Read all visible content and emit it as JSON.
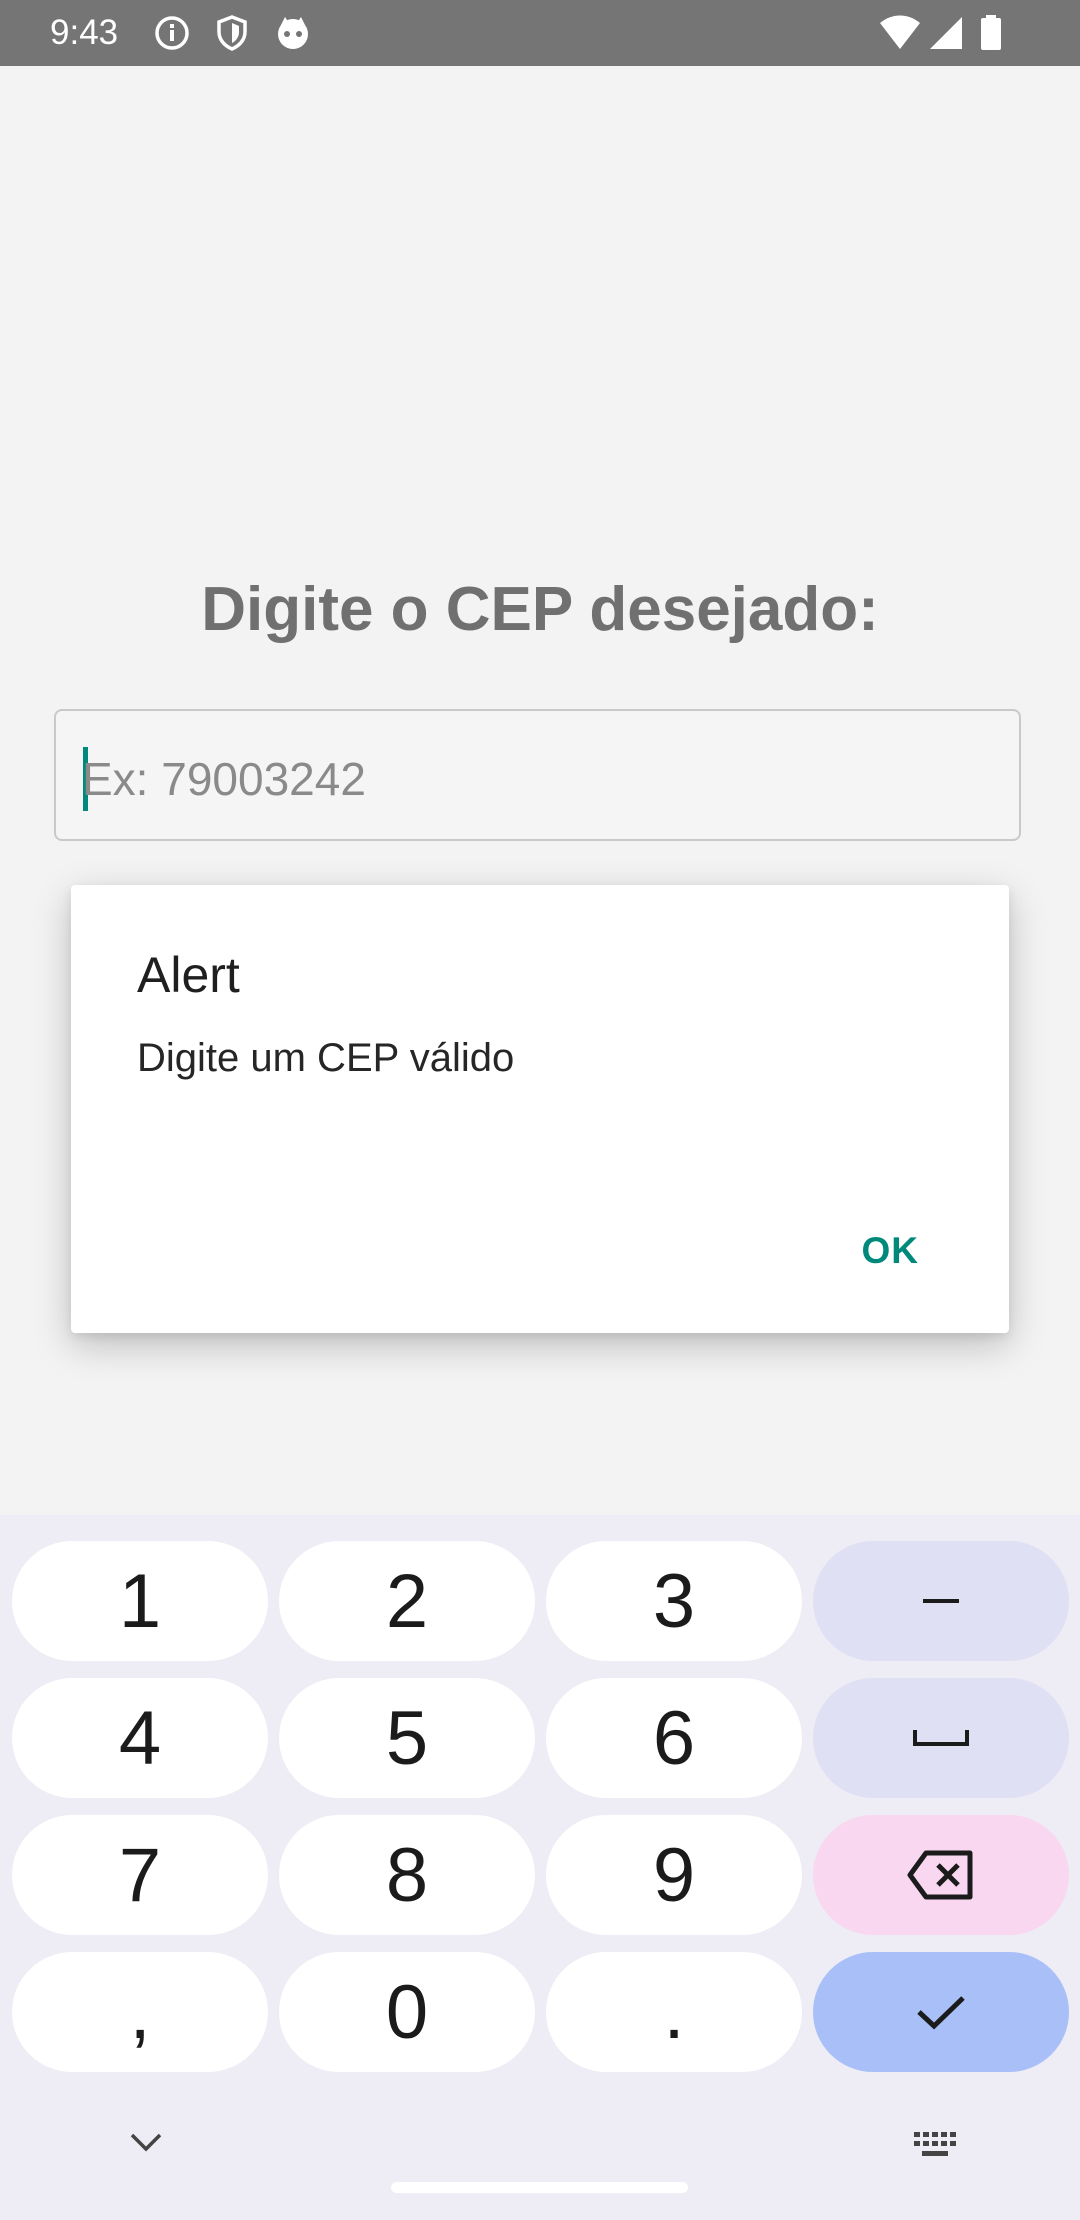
{
  "status_bar": {
    "time": "9:43",
    "left_icons": [
      "info-icon",
      "shield-icon",
      "notification-face-icon"
    ],
    "right_icons": [
      "wifi-icon",
      "cellular-icon",
      "battery-icon"
    ]
  },
  "main": {
    "prompt": "Digite o CEP desejado:",
    "cep_input": {
      "value": "",
      "placeholder": "Ex: 79003242"
    }
  },
  "dialog": {
    "title": "Alert",
    "message": "Digite um CEP válido",
    "ok_label": "OK"
  },
  "keyboard": {
    "rows": [
      [
        "1",
        "2",
        "3",
        "–"
      ],
      [
        "4",
        "5",
        "6",
        "␣"
      ],
      [
        "7",
        "8",
        "9",
        "⌫"
      ],
      [
        ",",
        "0",
        ".",
        "✓"
      ]
    ],
    "bottom_icons": [
      "chevron-down-icon",
      "keyboard-icon"
    ]
  },
  "colors": {
    "accent": "#00897b",
    "status_bar": "#757575",
    "key_function": "#dfe0f4",
    "key_delete": "#f9d7f0",
    "key_enter": "#a8bff7"
  }
}
